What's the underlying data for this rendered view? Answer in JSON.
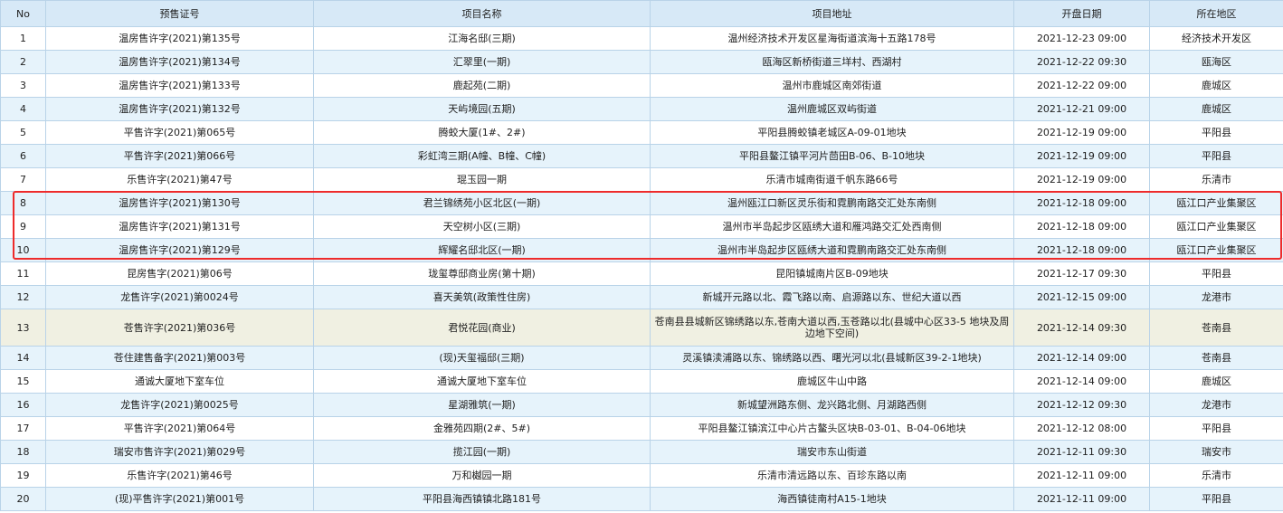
{
  "headers": {
    "no": "No",
    "permit": "预售证号",
    "project": "项目名称",
    "address": "项目地址",
    "date": "开盘日期",
    "district": "所在地区"
  },
  "rows": [
    {
      "no": "1",
      "permit": "温房售许字(2021)第135号",
      "project": "江海名邸(三期)",
      "address": "温州经济技术开发区星海街道滨海十五路178号",
      "date": "2021-12-23 09:00",
      "district": "经济技术开发区"
    },
    {
      "no": "2",
      "permit": "温房售许字(2021)第134号",
      "project": "汇翠里(一期)",
      "address": "瓯海区新桥街道三垟村、西湖村",
      "date": "2021-12-22 09:30",
      "district": "瓯海区"
    },
    {
      "no": "3",
      "permit": "温房售许字(2021)第133号",
      "project": "鹿起苑(二期)",
      "address": "温州市鹿城区南郊街道",
      "date": "2021-12-22 09:00",
      "district": "鹿城区"
    },
    {
      "no": "4",
      "permit": "温房售许字(2021)第132号",
      "project": "天屿境园(五期)",
      "address": "温州鹿城区双屿街道",
      "date": "2021-12-21 09:00",
      "district": "鹿城区"
    },
    {
      "no": "5",
      "permit": "平售许字(2021)第065号",
      "project": "腾蛟大厦(1#、2#)",
      "address": "平阳县腾蛟镇老城区A-09-01地块",
      "date": "2021-12-19 09:00",
      "district": "平阳县"
    },
    {
      "no": "6",
      "permit": "平售许字(2021)第066号",
      "project": "彩虹湾三期(A幢、B幢、C幢)",
      "address": "平阳县鳌江镇平河片茴田B-06、B-10地块",
      "date": "2021-12-19 09:00",
      "district": "平阳县"
    },
    {
      "no": "7",
      "permit": "乐售许字(2021)第47号",
      "project": "琨玉园一期",
      "address": "乐清市城南街道千帆东路66号",
      "date": "2021-12-19 09:00",
      "district": "乐清市"
    },
    {
      "no": "8",
      "permit": "温房售许字(2021)第130号",
      "project": "君兰锦绣苑小区北区(一期)",
      "address": "温州瓯江口新区灵乐街和霓鹏南路交汇处东南侧",
      "date": "2021-12-18 09:00",
      "district": "瓯江口产业集聚区"
    },
    {
      "no": "9",
      "permit": "温房售许字(2021)第131号",
      "project": "天空树小区(三期)",
      "address": "温州市半岛起步区瓯绣大道和雁鸿路交汇处西南侧",
      "date": "2021-12-18 09:00",
      "district": "瓯江口产业集聚区"
    },
    {
      "no": "10",
      "permit": "温房售许字(2021)第129号",
      "project": "辉耀名邸北区(一期)",
      "address": "温州市半岛起步区瓯绣大道和霓鹏南路交汇处东南侧",
      "date": "2021-12-18 09:00",
      "district": "瓯江口产业集聚区"
    },
    {
      "no": "11",
      "permit": "昆房售字(2021)第06号",
      "project": "珑玺尊邸商业房(第十期)",
      "address": "昆阳镇城南片区B-09地块",
      "date": "2021-12-17 09:30",
      "district": "平阳县"
    },
    {
      "no": "12",
      "permit": "龙售许字(2021)第0024号",
      "project": "喜天美筑(政策性住房)",
      "address": "新城开元路以北、霞飞路以南、启源路以东、世纪大道以西",
      "date": "2021-12-15 09:00",
      "district": "龙港市"
    },
    {
      "no": "13",
      "permit": "苍售许字(2021)第036号",
      "project": "君悦花园(商业)",
      "address": "苍南县县城新区锦绣路以东,苍南大道以西,玉苍路以北(县城中心区33-5 地块及周边地下空间)",
      "date": "2021-12-14 09:30",
      "district": "苍南县"
    },
    {
      "no": "14",
      "permit": "苍住建售备字(2021)第003号",
      "project": "(现)天玺福邸(三期)",
      "address": "灵溪镇渎浦路以东、锦绣路以西、曙光河以北(县城新区39-2-1地块)",
      "date": "2021-12-14 09:00",
      "district": "苍南县"
    },
    {
      "no": "15",
      "permit": "通诚大厦地下室车位",
      "project": "通诚大厦地下室车位",
      "address": "鹿城区牛山中路",
      "date": "2021-12-14 09:00",
      "district": "鹿城区"
    },
    {
      "no": "16",
      "permit": "龙售许字(2021)第0025号",
      "project": "星湖雅筑(一期)",
      "address": "新城望洲路东侧、龙兴路北侧、月湖路西侧",
      "date": "2021-12-12 09:30",
      "district": "龙港市"
    },
    {
      "no": "17",
      "permit": "平售许字(2021)第064号",
      "project": "金雅苑四期(2#、5#)",
      "address": "平阳县鳌江镇滨江中心片古鳌头区块B-03-01、B-04-06地块",
      "date": "2021-12-12 08:00",
      "district": "平阳县"
    },
    {
      "no": "18",
      "permit": "瑞安市售许字(2021)第029号",
      "project": "揽江园(一期)",
      "address": "瑞安市东山街道",
      "date": "2021-12-11 09:30",
      "district": "瑞安市"
    },
    {
      "no": "19",
      "permit": "乐售许字(2021)第46号",
      "project": "万和樾园一期",
      "address": "乐清市清远路以东、百珍东路以南",
      "date": "2021-12-11 09:00",
      "district": "乐清市"
    },
    {
      "no": "20",
      "permit": "(现)平售许字(2021)第001号",
      "project": "平阳县海西镇镇北路181号",
      "address": "海西镇徒南村A15-1地块",
      "date": "2021-12-11 09:00",
      "district": "平阳县"
    }
  ],
  "colors": {
    "header_bg": "#d7e9f7",
    "stripe": "#e6f3fb",
    "border": "#b9d3e8",
    "highlight": "#ee2b2b",
    "tall_row": "#f0f0e2"
  }
}
